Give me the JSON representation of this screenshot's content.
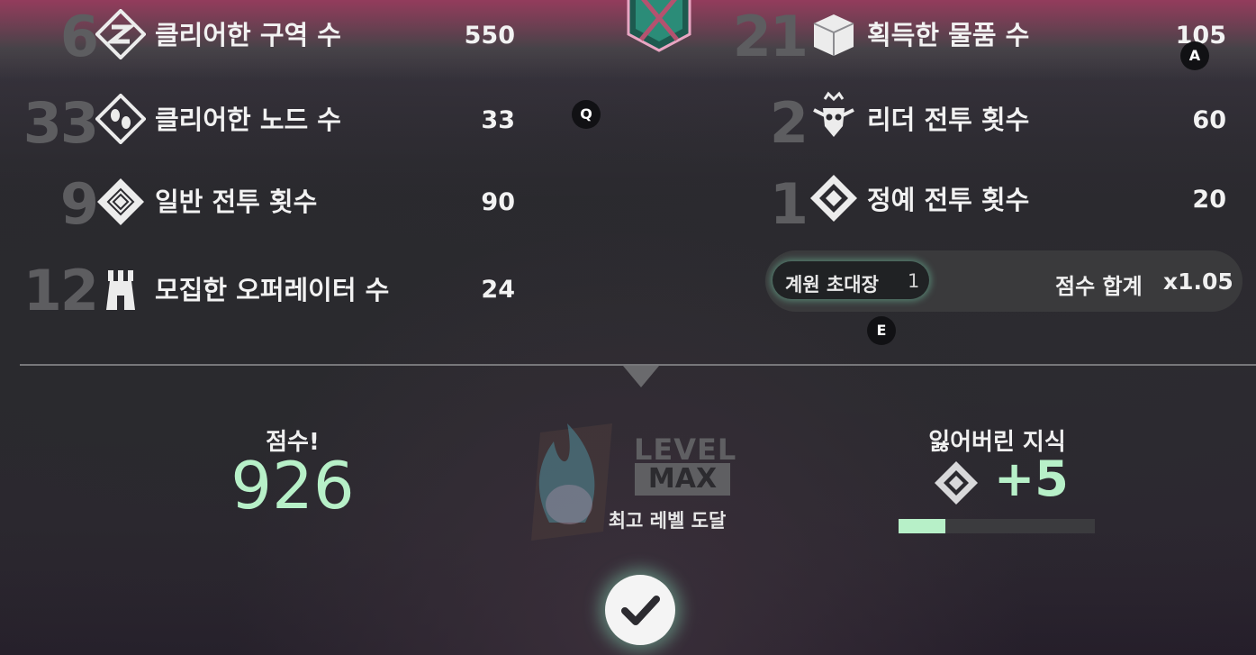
{
  "stats_left": [
    {
      "count": "6",
      "label": "클리어한 구역 수",
      "value": "550",
      "icon": "zone-icon"
    },
    {
      "count": "33",
      "label": "클리어한 노드 수",
      "value": "33",
      "icon": "footsteps-icon"
    },
    {
      "count": "9",
      "label": "일반 전투 횟수",
      "value": "90",
      "icon": "maze-icon"
    },
    {
      "count": "12",
      "label": "모집한 오퍼레이터 수",
      "value": "24",
      "icon": "tower-icon"
    }
  ],
  "stats_right": [
    {
      "count": "21",
      "label": "획득한 물품 수",
      "value": "105",
      "icon": "box-icon"
    },
    {
      "count": "2",
      "label": "리더 전투 횟수",
      "value": "60",
      "icon": "crowned-skull-icon"
    },
    {
      "count": "1",
      "label": "정예 전투 횟수",
      "value": "20",
      "icon": "elite-diamond-icon"
    }
  ],
  "hotkeys": {
    "a": "A",
    "q": "Q",
    "e": "E"
  },
  "bonus": {
    "invite_label": "계원 초대장",
    "invite_count": "1",
    "sum_label": "점수 합계",
    "multiplier": "x1.05"
  },
  "score": {
    "label": "점수!",
    "value": "926"
  },
  "level": {
    "line1": "LEVEL",
    "line2": "MAX",
    "caption": "최고 레벨 도달"
  },
  "knowledge": {
    "label": "잃어버린 지식",
    "value": "+5",
    "progress": 0.24
  },
  "colors": {
    "accent": "#b7f0c8",
    "count_gray": "#5d5d60",
    "bar_bg": "#3a3a3c"
  }
}
